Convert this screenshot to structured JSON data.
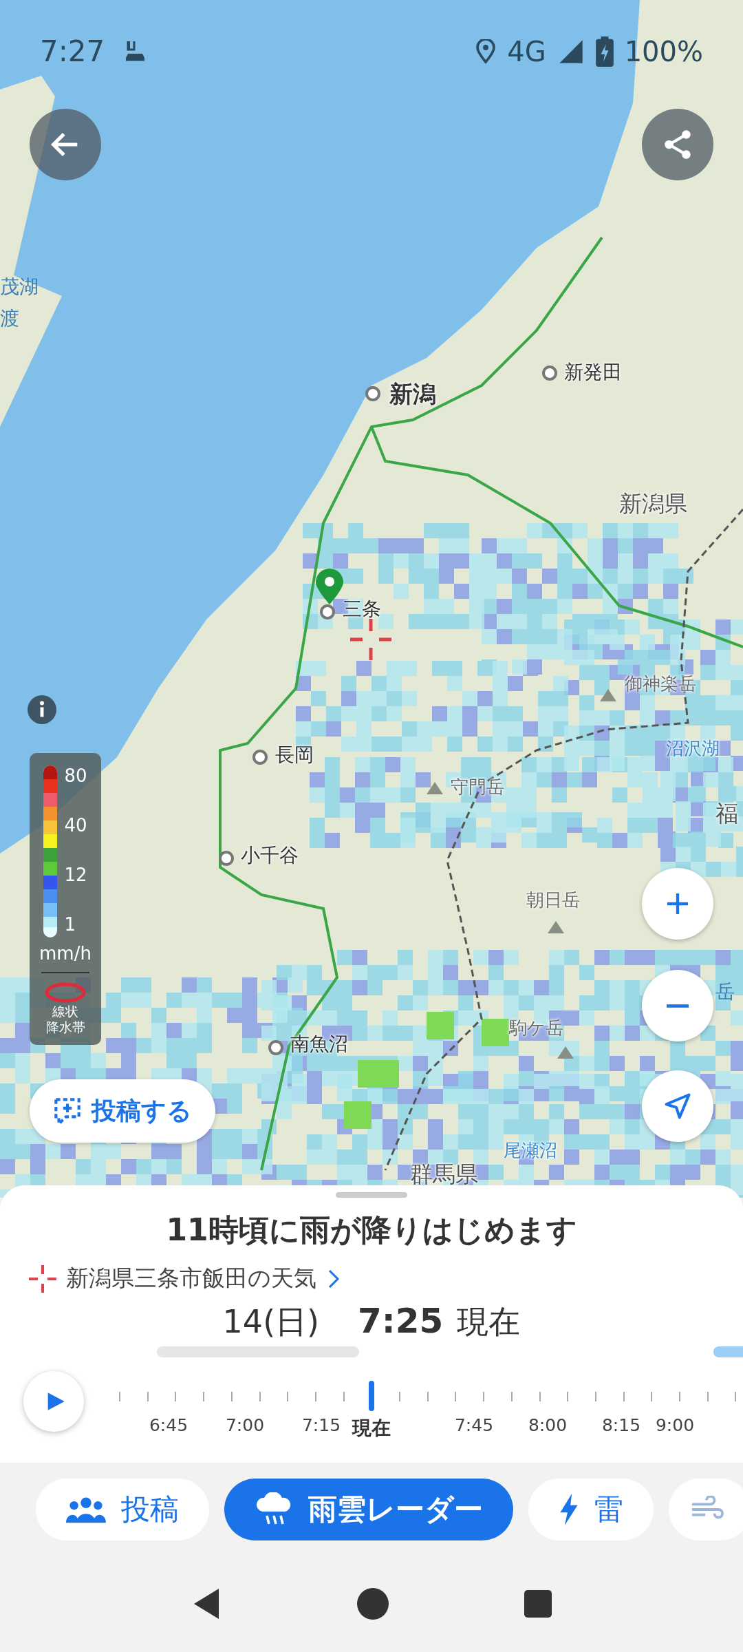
{
  "status_bar": {
    "time": "7:27",
    "network": "4G",
    "battery": "100%"
  },
  "map": {
    "labels": [
      {
        "text": "茂湖",
        "kind": "faint"
      },
      {
        "text": "渡",
        "kind": "faint"
      },
      {
        "text": "新潟",
        "kind": "city-major"
      },
      {
        "text": "新発田",
        "kind": "city"
      },
      {
        "text": "新潟県",
        "kind": "region"
      },
      {
        "text": "三条",
        "kind": "city"
      },
      {
        "text": "御神楽岳",
        "kind": "mountain"
      },
      {
        "text": "沼沢湖",
        "kind": "water"
      },
      {
        "text": "守門岳",
        "kind": "mountain"
      },
      {
        "text": "福",
        "kind": "region"
      },
      {
        "text": "長岡",
        "kind": "city"
      },
      {
        "text": "小千谷",
        "kind": "city"
      },
      {
        "text": "朝日岳",
        "kind": "mountain"
      },
      {
        "text": "岳",
        "kind": "faint"
      },
      {
        "text": "南魚沼",
        "kind": "city"
      },
      {
        "text": "駒ケ岳",
        "kind": "mountain"
      },
      {
        "text": "尾瀬沼",
        "kind": "water"
      },
      {
        "text": "群馬県",
        "kind": "region"
      }
    ]
  },
  "legend": {
    "values": [
      "80",
      "40",
      "12",
      "1"
    ],
    "unit": "mm/h",
    "band_label": [
      "線状",
      "降水帯"
    ]
  },
  "post_button": {
    "label": "投稿する"
  },
  "sheet": {
    "headline": "11時頃に雨が降りはじめます",
    "location": "新潟県三条市飯田の天気",
    "date": "14(日)",
    "time": "7:25",
    "time_suffix": "現在",
    "timeline": [
      {
        "label": "6:45",
        "selected": false
      },
      {
        "label": "7:00",
        "selected": false
      },
      {
        "label": "7:15",
        "selected": false
      },
      {
        "label": "現在",
        "selected": true
      },
      {
        "label": "7:45",
        "selected": false
      },
      {
        "label": "8:00",
        "selected": false
      },
      {
        "label": "8:15",
        "selected": false
      },
      {
        "label": "9:00",
        "selected": false
      }
    ]
  },
  "tabs": [
    {
      "label": "投稿",
      "kind": "people",
      "selected": false
    },
    {
      "label": "雨雲レーダー",
      "kind": "rain",
      "selected": true
    },
    {
      "label": "雷",
      "kind": "lightning",
      "selected": false
    },
    {
      "kind": "wind",
      "selected": false
    }
  ]
}
